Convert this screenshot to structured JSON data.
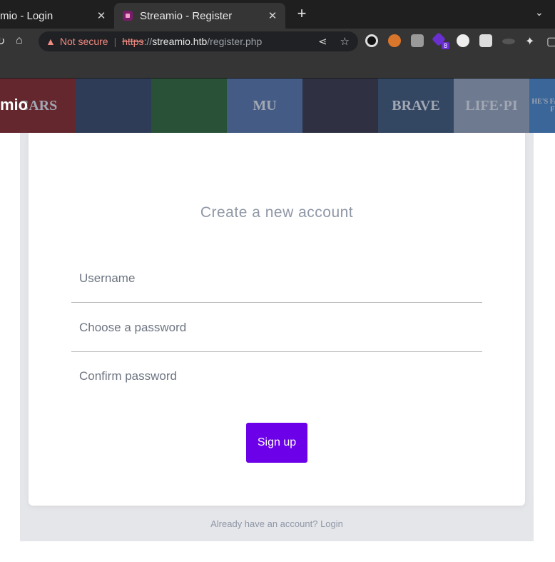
{
  "browser": {
    "tabs": [
      {
        "title": "mio - Login",
        "active": false
      },
      {
        "title": "Streamio - Register",
        "active": true
      }
    ],
    "address": {
      "warning": "Not secure",
      "scheme": "https",
      "separator": "://",
      "host": "streamio.htb",
      "path": "/register.php"
    },
    "extensions_badge": "8"
  },
  "hero": {
    "brand": "mio",
    "posters": [
      {
        "text": "CARS",
        "color": "#8c2a2a"
      },
      {
        "text": "",
        "color": "#3a4a6a"
      },
      {
        "text": "",
        "color": "#2f6a3a"
      },
      {
        "text": "MU",
        "color": "#5a7ab0"
      },
      {
        "text": "",
        "color": "#3a3a4a"
      },
      {
        "text": "BRAVE",
        "color": "#3f5a7a"
      },
      {
        "text": "LIFE·PI",
        "color": "#9aaac0"
      },
      {
        "text": "HE'S FAST. THEY'RE FURIOUS.",
        "color": "#4a8ad0"
      }
    ]
  },
  "form": {
    "heading": "Create a new account",
    "username_placeholder": "Username",
    "password_placeholder": "Choose a password",
    "confirm_placeholder": "Confirm password",
    "submit_label": "Sign up"
  },
  "footer": {
    "text": "Already have an account?",
    "link": "Login"
  },
  "colors": {
    "accent": "#6c00e8",
    "muted_text": "#8f97a6",
    "container_bg": "#e5e6ea"
  }
}
